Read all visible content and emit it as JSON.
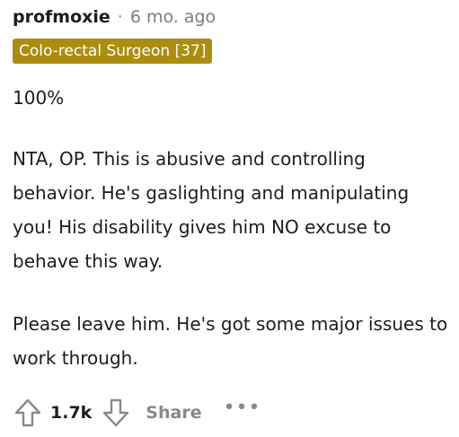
{
  "comment": {
    "username": "profmoxie",
    "separator": "·",
    "time": "6 mo. ago",
    "flair": "Colo-rectal Surgeon [37]",
    "paragraphs": [
      "100%",
      "NTA, OP. This is abusive and controlling behavior. He's gaslighting and manipulating you! His disability gives him NO excuse to behave this way.",
      "Please leave him. He's got some major issues to work through."
    ],
    "score": "1.7k",
    "share_label": "Share",
    "more_label": "•••"
  },
  "icons": {
    "upvote": "upvote-arrow-icon",
    "downvote": "downvote-arrow-icon",
    "more": "more-options-icon"
  },
  "colors": {
    "flair_bg": "#ad8d0f",
    "flair_text": "#ffffff",
    "muted": "#878a8c",
    "text": "#1c1c1c"
  }
}
